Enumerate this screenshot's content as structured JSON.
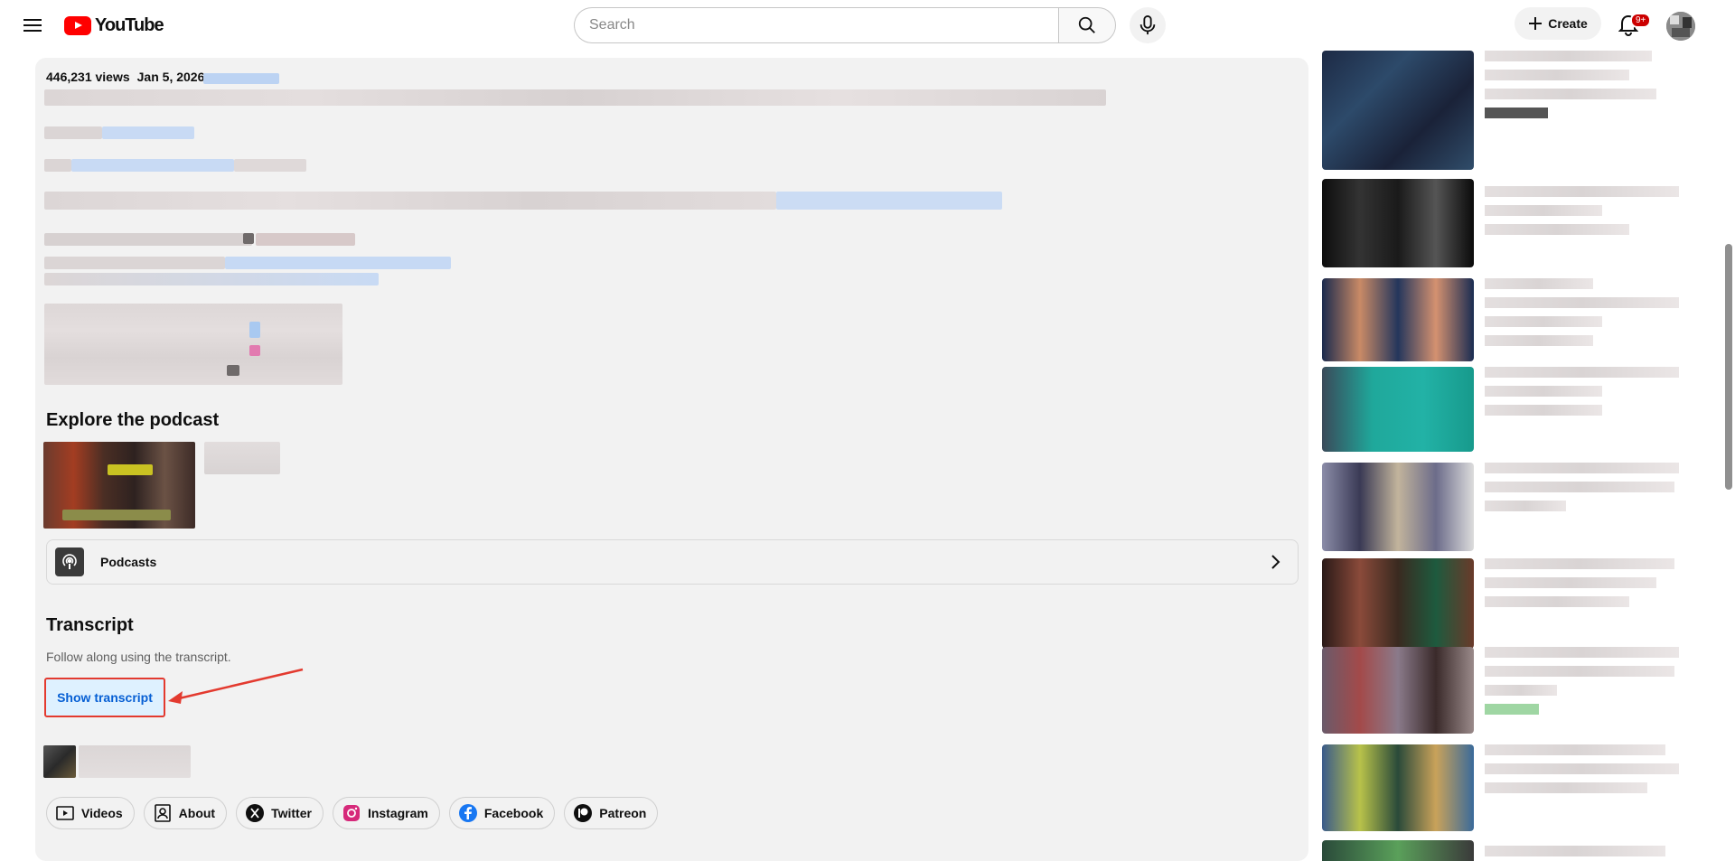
{
  "header": {
    "logo_text": "YouTube",
    "search_placeholder": "Search",
    "create_label": "Create",
    "notification_badge": "9+"
  },
  "video": {
    "views": "446,231 views",
    "date": "Jan 5, 2026"
  },
  "podcast": {
    "section_title": "Explore the podcast",
    "row_label": "Podcasts"
  },
  "transcript": {
    "title": "Transcript",
    "subtitle": "Follow along using the transcript.",
    "button_label": "Show transcript"
  },
  "channel_links": [
    {
      "label": "Videos",
      "icon": "video-icon"
    },
    {
      "label": "About",
      "icon": "person-icon"
    },
    {
      "label": "Twitter",
      "icon": "x-icon"
    },
    {
      "label": "Instagram",
      "icon": "instagram-icon"
    },
    {
      "label": "Facebook",
      "icon": "facebook-icon"
    },
    {
      "label": "Patreon",
      "icon": "patreon-icon"
    }
  ],
  "colors": {
    "brand_red": "#ff0000",
    "annotation_red": "#e33a2f",
    "link_blue": "#065fd4",
    "button_bg": "#def1ff"
  }
}
